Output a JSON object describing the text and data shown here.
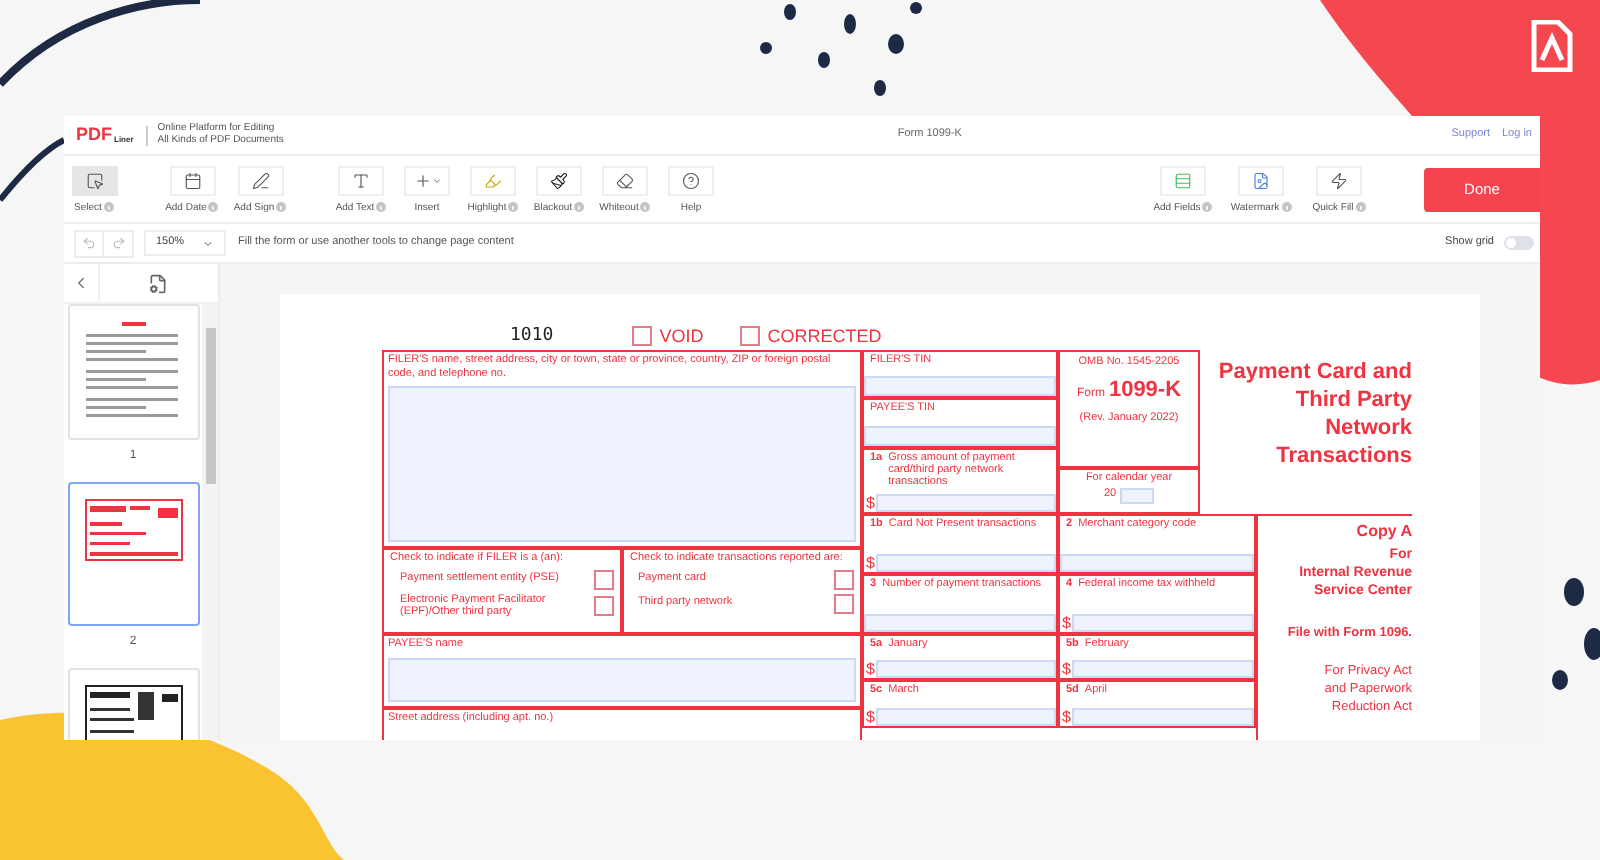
{
  "header": {
    "logo": {
      "main": "PDF",
      "sub": "Liner"
    },
    "tagline": "Online Platform for Editing\nAll Kinds of PDF Documents",
    "title": "Form 1099-K",
    "links": [
      "Support",
      "Log in"
    ]
  },
  "toolbar": {
    "groups": [
      {
        "tools": [
          {
            "label": "Select",
            "selected": true,
            "info": true
          }
        ]
      },
      {
        "tools": [
          {
            "label": "Add Date",
            "selected": false,
            "info": true
          },
          {
            "label": "Add Sign",
            "selected": false,
            "info": true
          }
        ]
      },
      {
        "tools": [
          {
            "label": "Add Text",
            "selected": false,
            "info": true
          },
          {
            "label": "Insert",
            "selected": false,
            "info": false
          },
          {
            "label": "Highlight",
            "selected": false,
            "info": true
          },
          {
            "label": "Blackout",
            "selected": false,
            "info": true
          },
          {
            "label": "Whiteout",
            "selected": false,
            "info": true
          },
          {
            "label": "Help",
            "selected": false,
            "info": false
          }
        ]
      },
      {
        "tools": [
          {
            "label": "Add Fields",
            "selected": false,
            "info": true
          },
          {
            "label": "Watermark",
            "selected": false,
            "info": true
          },
          {
            "label": "Quick Fill",
            "selected": false,
            "info": true
          }
        ]
      }
    ],
    "done": "Done"
  },
  "subbar": {
    "zoom": "150%",
    "hint": "Fill the form or use another tools to change page content",
    "grid": {
      "label": "Show grid",
      "on": false
    }
  },
  "sidebar": {
    "pages": [
      {
        "label": "1",
        "selected": false,
        "kind": "text"
      },
      {
        "label": "2",
        "selected": true,
        "kind": "form"
      },
      {
        "selected": false,
        "kind": "scan"
      }
    ]
  },
  "form": {
    "number": "1010",
    "marks": [
      {
        "label": "VOID",
        "checked": false
      },
      {
        "label": "CORRECTED",
        "checked": false
      }
    ],
    "filer_name": "FILER'S name, street address, city or town, state or province, country, ZIP or foreign postal code, and telephone no.",
    "filer_type": {
      "label": "Check to indicate if FILER is a (an):",
      "options": [
        {
          "label": "Payment settlement entity (PSE)",
          "checked": false
        },
        {
          "label": "Electronic Payment Facilitator (EPF)/Other third party",
          "checked": false
        }
      ]
    },
    "transactions": {
      "label": "Check to indicate transactions reported are:",
      "options": [
        {
          "label": "Payment card",
          "checked": false
        },
        {
          "label": "Third party network",
          "checked": false
        }
      ]
    },
    "payee_name": "PAYEE'S name",
    "street": "Street address (including apt. no.)",
    "filer_tin": "FILER'S TIN",
    "payee_tin": "PAYEE'S TIN",
    "omb": {
      "omb": "OMB No. 1545-2205",
      "form_word": "Form",
      "form_number": "1099-K",
      "revision": "(Rev. January 2022)"
    },
    "calendar": {
      "label": "For calendar year",
      "prefix": "20"
    },
    "title": "Payment Card and\nThird Party\nNetwork\nTransactions",
    "boxes": [
      {
        "number": "1a",
        "label": "Gross amount of payment card/third party network transactions",
        "currency": "$"
      },
      {
        "number": "1b",
        "label": "Card Not Present transactions",
        "currency": "$"
      },
      {
        "number": "2",
        "label": "Merchant category code"
      },
      {
        "number": "3",
        "label": "Number of payment transactions"
      },
      {
        "number": "4",
        "label": "Federal income tax withheld",
        "currency": "$"
      },
      {
        "number": "5a",
        "label": "January",
        "currency": "$"
      },
      {
        "number": "5b",
        "label": "February",
        "currency": "$"
      },
      {
        "number": "5c",
        "label": "March",
        "currency": "$"
      },
      {
        "number": "5d",
        "label": "April",
        "currency": "$"
      }
    ],
    "copy": {
      "copy": "Copy A",
      "for": "For",
      "agency": "Internal Revenue\nService Center",
      "file": "File with Form 1096.",
      "privacy": "For Privacy Act\nand Paperwork\nReduction Act"
    }
  }
}
